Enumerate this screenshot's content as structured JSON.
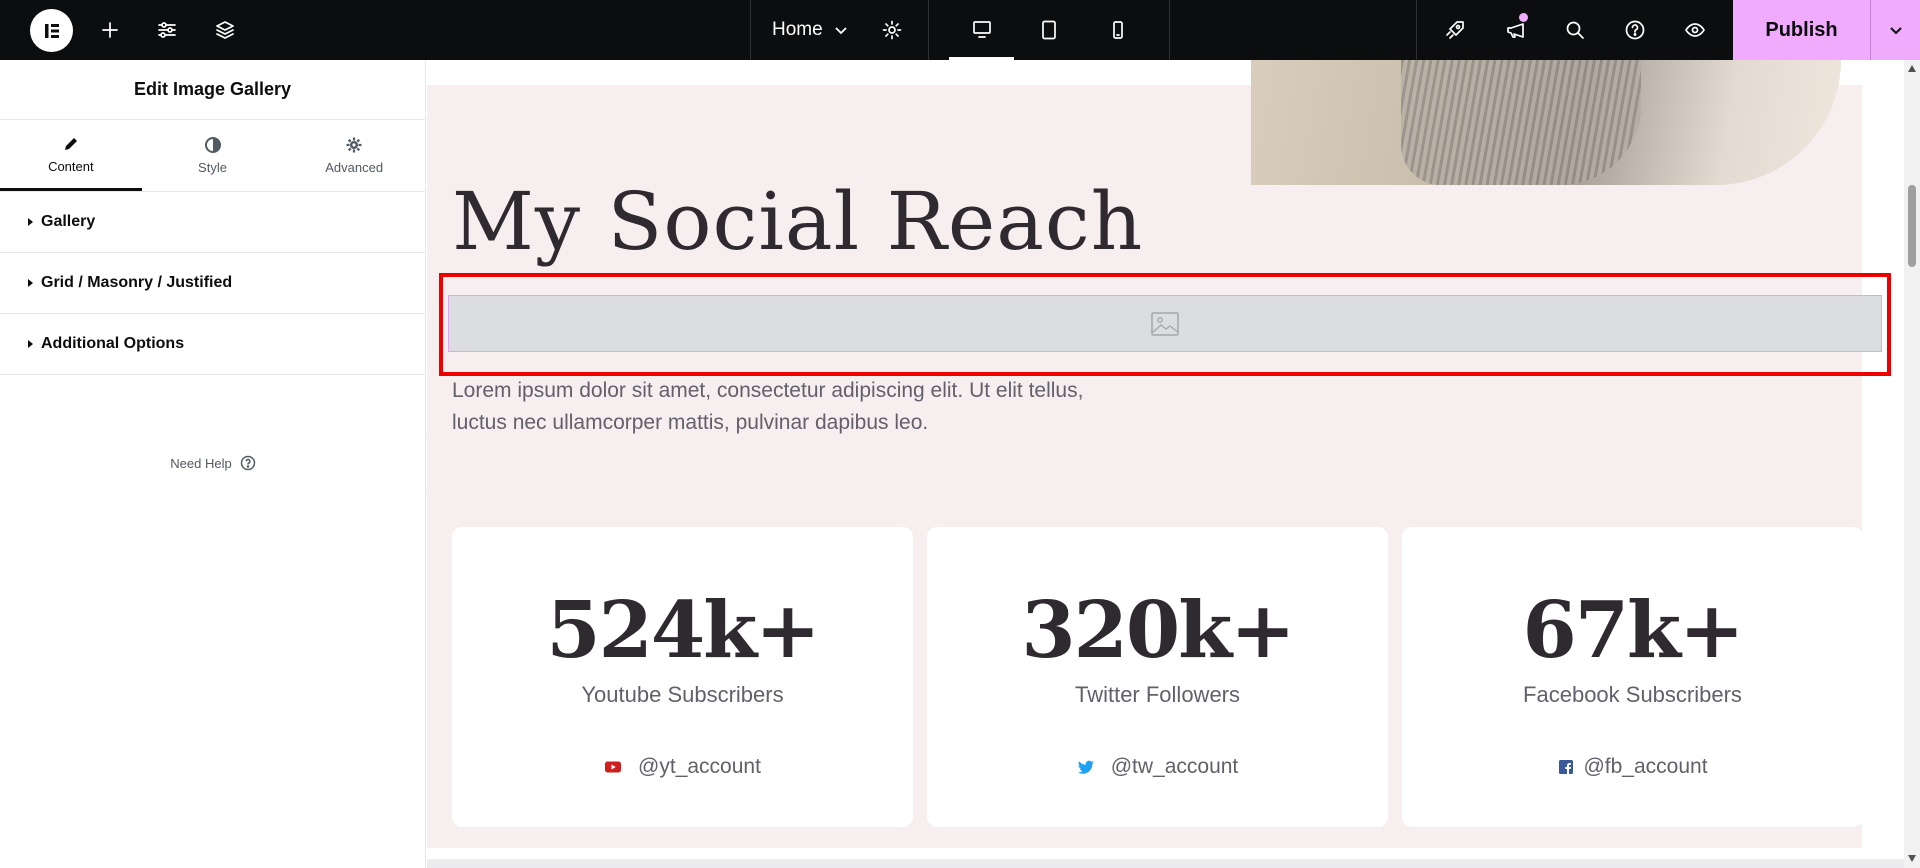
{
  "topbar": {
    "page_name": "Home",
    "publish_label": "Publish"
  },
  "panel": {
    "title": "Edit Image Gallery",
    "tabs": [
      {
        "label": "Content",
        "active": true
      },
      {
        "label": "Style",
        "active": false
      },
      {
        "label": "Advanced",
        "active": false
      }
    ],
    "sections": [
      {
        "label": "Gallery"
      },
      {
        "label": "Grid / Masonry / Justified"
      },
      {
        "label": "Additional Options"
      }
    ],
    "help_label": "Need Help"
  },
  "canvas": {
    "heading": "My Social Reach",
    "body_text": "Lorem ipsum dolor sit amet, consectetur adipiscing elit. Ut elit tellus, luctus nec ullamcorper mattis, pulvinar dapibus leo.",
    "cards": [
      {
        "number": "524k+",
        "label": "Youtube Subscribers",
        "handle": "@yt_account",
        "icon": "youtube-icon"
      },
      {
        "number": "320k+",
        "label": "Twitter Followers",
        "handle": "@tw_account",
        "icon": "twitter-icon"
      },
      {
        "number": "67k+",
        "label": "Facebook Subscribers",
        "handle": "@fb_account",
        "icon": "facebook-icon"
      }
    ]
  },
  "colors": {
    "topbar_bg": "#0c0d0e",
    "publish_accent": "#f0abfc",
    "section_bg": "#f7efef",
    "selection_outline": "#ef0000",
    "youtube_red": "#cd201f",
    "twitter_blue": "#1da1f2",
    "facebook_blue": "#3b5998"
  }
}
